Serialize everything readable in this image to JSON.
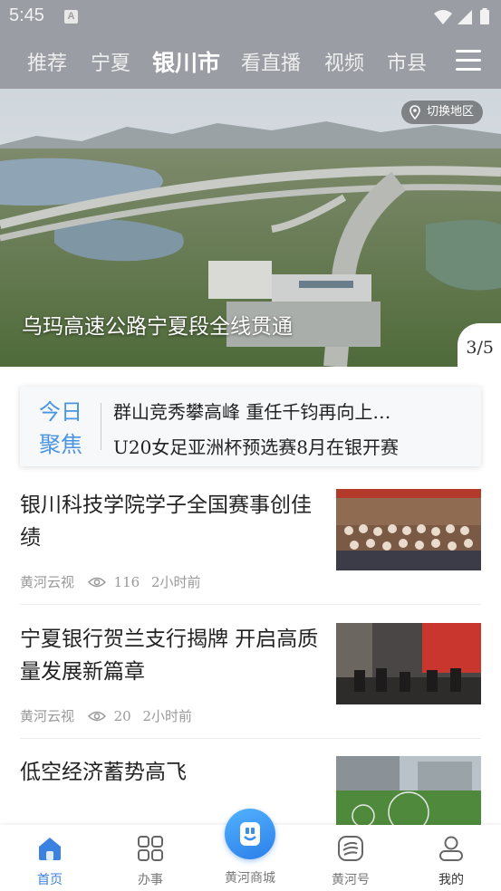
{
  "status_bar": {
    "time": "5:45",
    "notification_letter": "A"
  },
  "tabs": [
    {
      "label": "推荐"
    },
    {
      "label": "宁夏"
    },
    {
      "label": "银川市"
    },
    {
      "label": "看直播"
    },
    {
      "label": "视频"
    },
    {
      "label": "市县"
    }
  ],
  "active_tab": "银川市",
  "hero": {
    "caption": "乌玛高速公路宁夏段全线贯通",
    "region_button": "切换地区",
    "pager": "3/5"
  },
  "focus": {
    "label_line1": "今日",
    "label_line2": "聚焦",
    "items": [
      "群山竞秀攀高峰 重任千钧再向上…",
      "U20女足亚洲杯预选赛8月在银开赛"
    ]
  },
  "news": [
    {
      "title": "银川科技学院学子全国赛事创佳绩",
      "source": "黄河云视",
      "views": "116",
      "time": "2小时前"
    },
    {
      "title": "宁夏银行贺兰支行揭牌 开启高质量发展新篇章",
      "source": "黄河云视",
      "views": "20",
      "time": "2小时前"
    },
    {
      "title": "低空经济蓄势高飞",
      "source": "",
      "views": "",
      "time": ""
    }
  ],
  "bottom_nav": {
    "items": [
      {
        "label": "首页",
        "icon": "home-icon",
        "active": true
      },
      {
        "label": "办事",
        "icon": "grid-icon",
        "active": false
      },
      {
        "label": "黄河商城",
        "icon": "mall-icon",
        "active": false
      },
      {
        "label": "黄河号",
        "icon": "yellow-river-icon",
        "active": false
      },
      {
        "label": "我的",
        "icon": "user-icon",
        "active": false
      }
    ]
  },
  "colors": {
    "header_bg": "#9a9da3",
    "accent": "#3b82e0",
    "focus_label": "#4a94e0"
  }
}
